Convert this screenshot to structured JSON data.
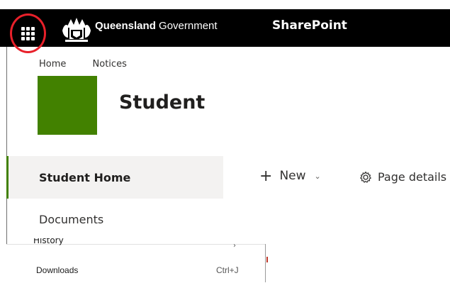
{
  "suite_bar": {
    "brand_bold": "Queensland",
    "brand_light": " Government",
    "app_name": "SharePoint",
    "waffle_icon": "app-launcher-icon",
    "crest_icon": "queensland-crest-icon",
    "highlight_color": "#e8202a"
  },
  "site": {
    "breadcrumbs": [
      "Home",
      "Notices"
    ],
    "title": "Student",
    "logo_color": "#428100"
  },
  "nav": {
    "items": [
      {
        "label": "Student Home",
        "selected": true
      },
      {
        "label": "Documents",
        "selected": false
      }
    ]
  },
  "command_bar": {
    "new_label": "New",
    "page_details_label": "Page details"
  },
  "context_menu": {
    "partial_item": "History",
    "downloads_label": "Downloads",
    "downloads_shortcut": "Ctrl+J"
  }
}
